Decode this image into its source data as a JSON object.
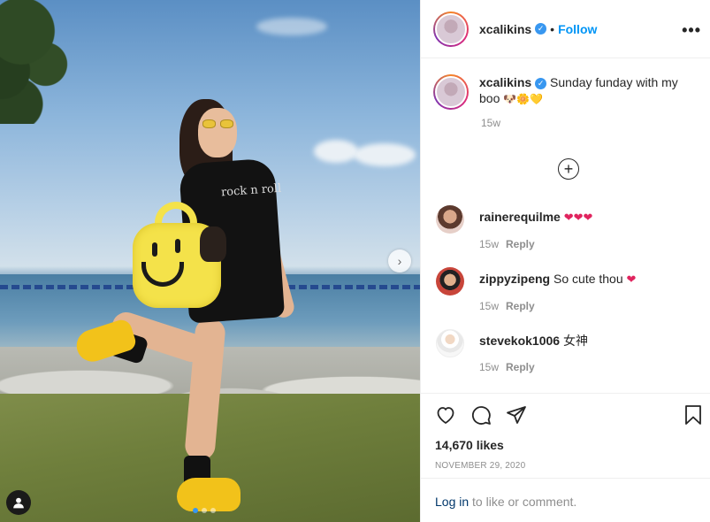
{
  "author": {
    "username": "xcalikins",
    "verified_icon": "verified-badge-icon",
    "separator": "•",
    "follow_label": "Follow",
    "more_label": "•••"
  },
  "caption": {
    "username": "xcalikins",
    "text": "Sunday funday with my boo",
    "emojis": "🐶🌼💛",
    "time": "15w"
  },
  "load_more_label": "+",
  "comments": [
    {
      "username": "rainerequilme",
      "text": "",
      "emojis": "❤❤❤",
      "time": "15w",
      "reply_label": "Reply"
    },
    {
      "username": "zippyzipeng",
      "text": "So cute thou",
      "emojis": "❤",
      "time": "15w",
      "reply_label": "Reply"
    },
    {
      "username": "stevekok1006",
      "text": "女神",
      "emojis": "",
      "time": "15w",
      "reply_label": "Reply"
    }
  ],
  "likes": "14,670 likes",
  "date": "NOVEMBER 29, 2020",
  "login": {
    "link": "Log in",
    "rest": " to like or comment."
  },
  "photo": {
    "shirt_text": "rock n roll",
    "next_arrow": "›",
    "carousel_count": 3,
    "carousel_active": 0
  },
  "colors": {
    "accent": "#0095f6",
    "heart": "#e0245e",
    "link": "#00376b"
  }
}
